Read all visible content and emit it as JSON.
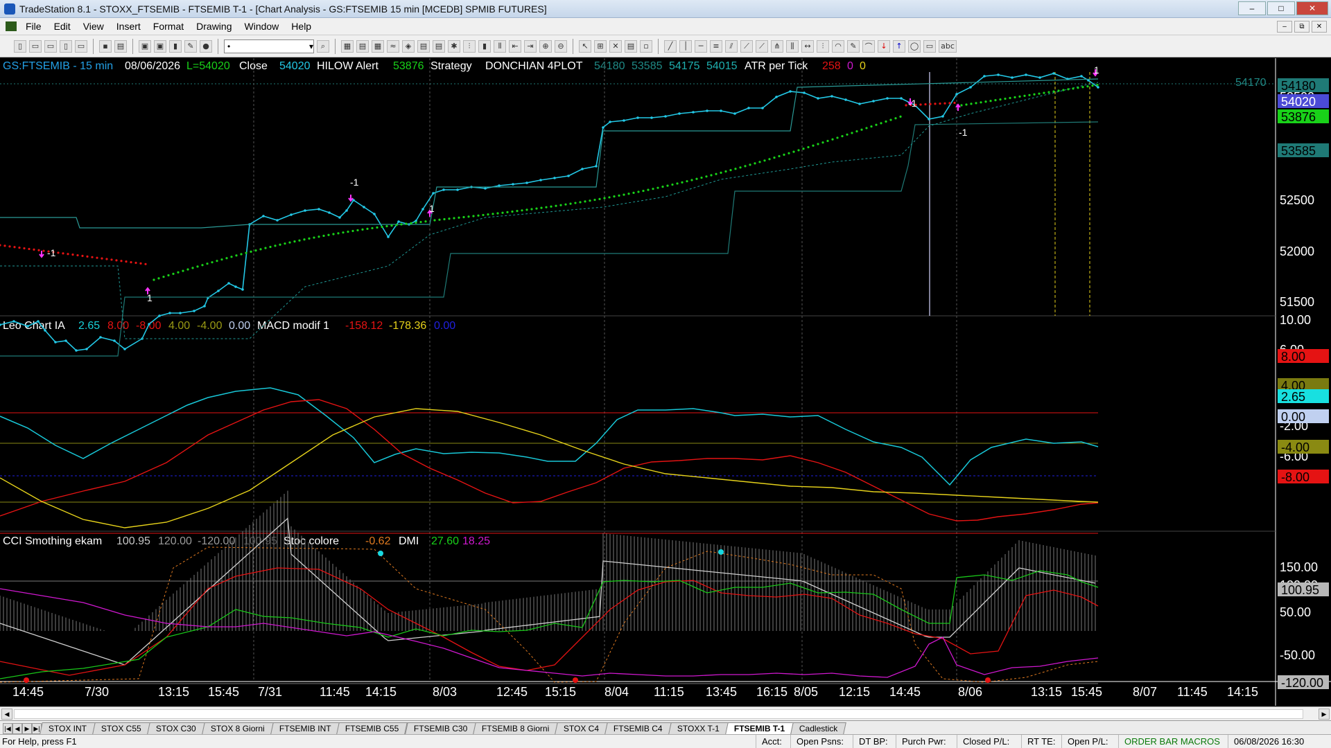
{
  "window": {
    "title": "TradeStation 8.1 - STOXX_FTSEMIB - FTSEMIB T-1 - [Chart Analysis - GS:FTSEMIB  15 min  [MCEDB] SPMIB FUTURES]",
    "min": "–",
    "max": "□",
    "close": "✕"
  },
  "menu": {
    "items": [
      "File",
      "Edit",
      "View",
      "Insert",
      "Format",
      "Drawing",
      "Window",
      "Help"
    ],
    "mdi_min": "–",
    "mdi_restore": "⧉",
    "mdi_close": "✕"
  },
  "toolbar": {
    "combo_value": "•",
    "combo_arrow": "▾",
    "abc": "abc"
  },
  "header": {
    "symbol": "GS:FTSEMIB - 15 min",
    "date": "08/06/2026",
    "last": "L=54020",
    "close_label": "Close",
    "close_value": "54020",
    "hilow_label": "HILOW Alert",
    "hilow_value": "53876",
    "strategy_label": "Strategy",
    "donchian_label": "DONCHIAN 4PLOT",
    "donchian_values": [
      "54180",
      "53585",
      "54175",
      "54015"
    ],
    "atr_label": "ATR per Tick",
    "atr_values": [
      "258",
      "0",
      "0"
    ],
    "last_right": "54170"
  },
  "price_axis": {
    "ticks": [
      "53500",
      "53000",
      "52500",
      "52000",
      "51500"
    ],
    "tags": [
      {
        "text": "54180",
        "bg": "#1f7a76",
        "fg": "#000"
      },
      {
        "text": "54020",
        "bg": "#4b4bd6",
        "fg": "#fff"
      },
      {
        "text": "53876",
        "bg": "#19d219",
        "fg": "#000"
      },
      {
        "text": "53585",
        "bg": "#1f7a76",
        "fg": "#000"
      }
    ]
  },
  "trade_markers": [
    "-1",
    "-1",
    "-1",
    "1",
    "1",
    "1",
    "-1"
  ],
  "panel2": {
    "label": "Leo Chart IA",
    "values": [
      "2.65",
      "8.00",
      "-8.00",
      "4.00",
      "-4.00",
      "0.00"
    ],
    "macd_label": "MACD modif 1",
    "macd_values": [
      "-158.12",
      "-178.36",
      "0.00"
    ],
    "ticks": [
      "10.00",
      "6.00",
      "-2.00",
      "-6.00"
    ],
    "tags": [
      {
        "text": "8.00",
        "bg": "#e51313",
        "fg": "#000"
      },
      {
        "text": "4.00",
        "bg": "#7a7a10",
        "fg": "#000"
      },
      {
        "text": "2.65",
        "bg": "#18e0e0",
        "fg": "#000"
      },
      {
        "text": "0.00",
        "bg": "#c0d0f0",
        "fg": "#000"
      },
      {
        "text": "-4.00",
        "bg": "#8a8a12",
        "fg": "#000"
      },
      {
        "text": "-8.00",
        "bg": "#e51313",
        "fg": "#000"
      }
    ]
  },
  "panel3": {
    "label": "CCI Smothing ekam",
    "values": [
      "100.95",
      "120.00",
      "-120.00",
      "100.95"
    ],
    "stoc_label": "Stoc colore",
    "stoc_value": "-0.62",
    "dmi_label": "DMI",
    "dmi_values": [
      "27.60",
      "18.25"
    ],
    "ticks": [
      "150.00",
      "120.00",
      "50.00",
      "-50.00"
    ],
    "tags": [
      {
        "text": "100.95",
        "bg": "#b8b8b8",
        "fg": "#000"
      },
      {
        "text": "-120.00",
        "bg": "#b8b8b8",
        "fg": "#000"
      }
    ]
  },
  "time_axis": [
    "14:45",
    "7/30",
    "13:15",
    "15:45",
    "7/31",
    "11:45",
    "14:15",
    "8/03",
    "12:45",
    "15:15",
    "8/04",
    "11:15",
    "13:45",
    "16:15",
    "8/05",
    "12:15",
    "14:45",
    "8/06",
    "13:15",
    "15:45",
    "8/07",
    "11:45",
    "14:15"
  ],
  "tabs": [
    "STOX INT",
    "STOX C55",
    "STOX  C30",
    "STOX  8 Giorni",
    "FTSEMIB INT",
    "FTSEMIB C55",
    "FTSEMIB C30",
    "FTSEMIB  8 Giorni",
    "STOX  C4",
    "FTSEMIB C4",
    "STOXX T-1",
    "FTSEMIB T-1",
    "Cadlestick"
  ],
  "active_tab": "FTSEMIB T-1",
  "status": {
    "help": "For Help, press F1",
    "acct": "Acct:",
    "open_psns": "Open Psns:",
    "dt_bp": "DT BP:",
    "purch_pwr": "Purch Pwr:",
    "closed_pl": "Closed P/L:",
    "rt_te": "RT TE:",
    "open_pl": "Open P/L:",
    "macros": "ORDER BAR  MACROS",
    "datetime": "06/08/2026 16:30"
  },
  "colors": {
    "price": "#23c8e6",
    "donchian": "#1f7a76",
    "trail_green": "#19d219",
    "trail_red": "#e51313",
    "arrow": "#ff33ff",
    "macd_red": "#e51313",
    "macd_yellow": "#e6d21a",
    "leo": "#18c8d8",
    "cci_red": "#e51313",
    "cci_white": "#d0d0d0",
    "dmi_green": "#19c819",
    "dmi_magenta": "#d018d0"
  }
}
